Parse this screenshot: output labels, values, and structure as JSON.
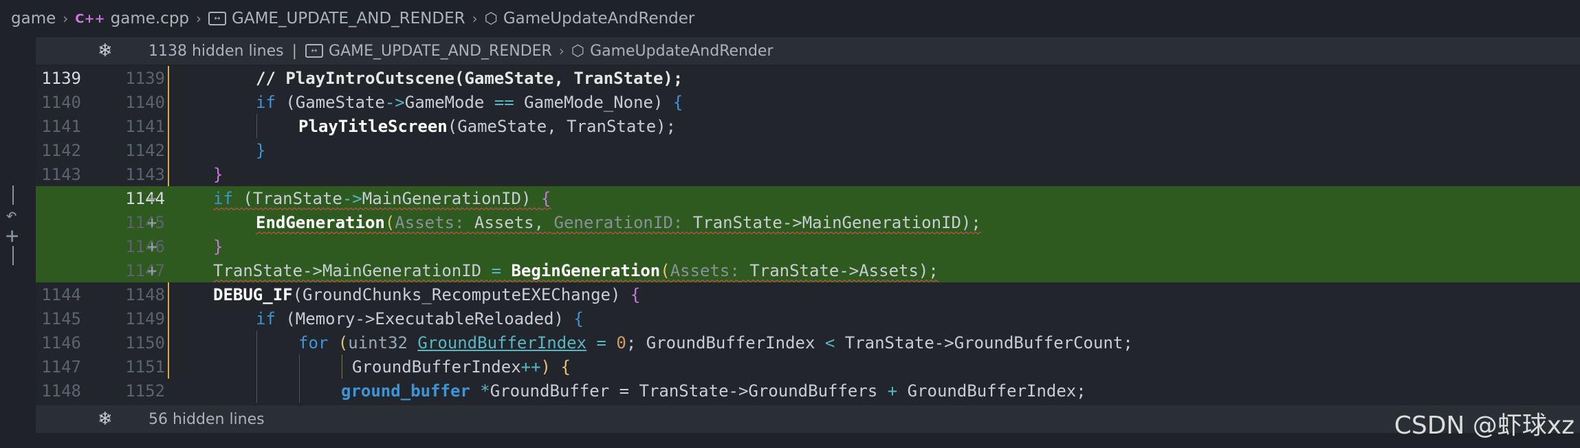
{
  "breadcrumb": {
    "items": [
      "game",
      "game.cpp",
      "GAME_UPDATE_AND_RENDER",
      "GameUpdateAndRender"
    ],
    "file_badge": "C++"
  },
  "hidden_top": {
    "text": "1138 hidden lines",
    "crumb1": "GAME_UPDATE_AND_RENDER",
    "crumb2": "GameUpdateAndRender"
  },
  "hidden_bottom": {
    "text": "56 hidden lines"
  },
  "lines": [
    {
      "old": "1139",
      "new": "1139"
    },
    {
      "old": "1140",
      "new": "1140"
    },
    {
      "old": "1141",
      "new": "1141"
    },
    {
      "old": "1142",
      "new": "1142"
    },
    {
      "old": "1143",
      "new": "1143"
    },
    {
      "old": "",
      "new": "1144",
      "mark": "+"
    },
    {
      "old": "",
      "new": "1145",
      "mark": "+"
    },
    {
      "old": "",
      "new": "1146",
      "mark": "+"
    },
    {
      "old": "",
      "new": "1147",
      "mark": "+"
    },
    {
      "old": "1144",
      "new": "1148"
    },
    {
      "old": "1145",
      "new": "1149"
    },
    {
      "old": "1146",
      "new": "1150"
    },
    {
      "old": "1147",
      "new": "1151"
    },
    {
      "old": "1148",
      "new": "1152"
    }
  ],
  "code": {
    "l1": "// PlayIntroCutscene(GameState, TranState);",
    "l2a": "if",
    "l2b": " (GameState",
    "l2c": "->",
    "l2d": "GameMode ",
    "l2e": "==",
    "l2f": " GameMode_None) ",
    "l3a": "PlayTitleScreen",
    "l3b": "(GameState, TranState);",
    "l6a": "if",
    "l6b": " (TranState",
    "l6c": "->",
    "l6d": "MainGenerationID) ",
    "l7a": "EndGeneration",
    "l7b": "(",
    "l7c": "Assets:",
    "l7d": " Assets, ",
    "l7e": "GenerationID:",
    "l7f": " TranState->MainGenerationID);",
    "l9a": "TranState->MainGenerationID ",
    "l9b": "=",
    "l9c": "BeginGeneration",
    "l9d": "(",
    "l9e": "Assets:",
    "l9f": " TranState->Assets);",
    "l10a": "DEBUG_IF",
    "l10b": "(GroundChunks_RecomputeEXEChange) ",
    "l11a": "if",
    "l11b": " (Memory->ExecutableReloaded) ",
    "l12a": "for",
    "l12b": " (",
    "l12c": "uint32 ",
    "l12d": "GroundBufferIndex",
    "l12e": " = ",
    "l12f": "0",
    "l12g": "; GroundBufferIndex ",
    "l12h": "<",
    "l12i": " TranState->GroundBufferCount;",
    "l13a": "GroundBufferIndex",
    "l13b": "++",
    "l13c": ") ",
    "l14a": "ground_buffer",
    "l14b": " *",
    "l14c": "GroundBuffer = TranState->GroundBuffers ",
    "l14d": "+",
    "l14e": " GroundBufferIndex;"
  },
  "watermark": "CSDN @虾球xz"
}
